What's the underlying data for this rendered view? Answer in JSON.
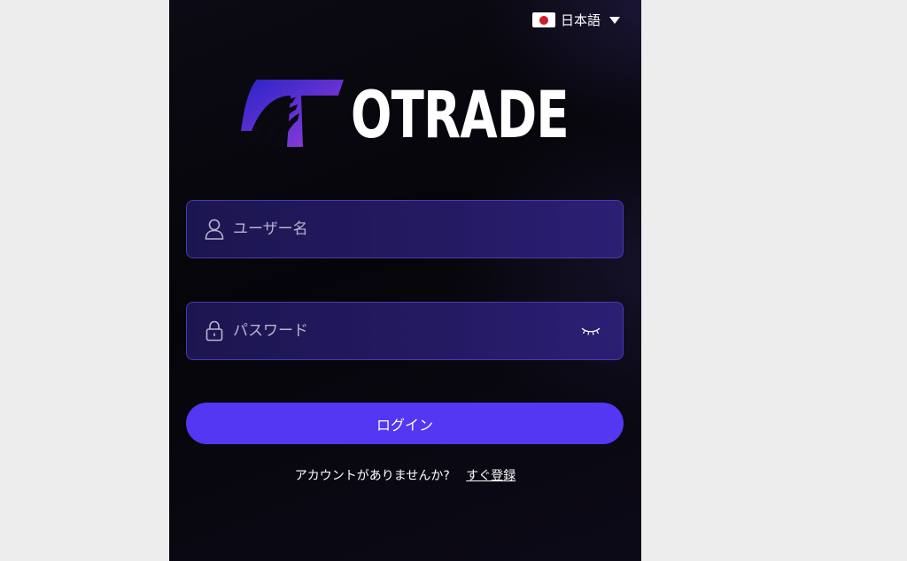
{
  "language": {
    "label": "日本語",
    "flag_icon": "japan-flag-icon",
    "flag_color": "#d11a2a"
  },
  "logo": {
    "text": "OTRADE",
    "mark_icon": "otrade-logo-mark",
    "gradient_start": "#3b2ad6",
    "gradient_end": "#9a3fd8"
  },
  "username": {
    "placeholder": "ユーザー名",
    "value": "",
    "icon": "user-icon"
  },
  "password": {
    "placeholder": "パスワード",
    "value": "",
    "icon": "lock-icon",
    "toggle_icon": "eye-closed-icon"
  },
  "login": {
    "label": "ログイン",
    "color": "#5337f2"
  },
  "signup": {
    "prompt": "アカウントがありませんか?",
    "link": "すぐ登録"
  },
  "colors": {
    "page_bg": "#ededed",
    "panel_bg": "#07060b",
    "field_border": "#4a39b7"
  }
}
